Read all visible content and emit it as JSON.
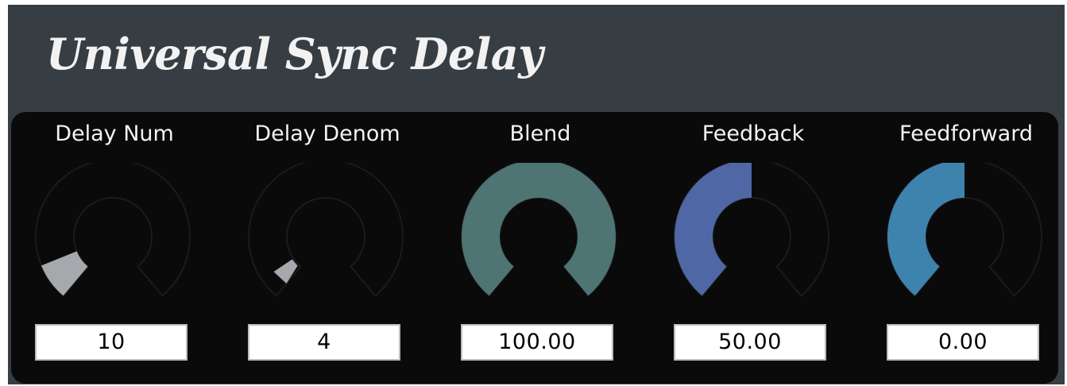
{
  "title": "Universal Sync Delay",
  "controls": [
    {
      "label": "Delay Num",
      "value": "10",
      "fraction": 0.1,
      "color": "#a5a8ac",
      "fill_mode": "pointer"
    },
    {
      "label": "Delay Denom",
      "value": "4",
      "fraction": 0.04,
      "color": "#a5a8ac",
      "fill_mode": "pointer"
    },
    {
      "label": "Blend",
      "value": "100.00",
      "fraction": 1.0,
      "color": "#4e7474",
      "fill_mode": "range"
    },
    {
      "label": "Feedback",
      "value": "50.00",
      "fraction": 0.5,
      "color": "#5067a6",
      "fill_mode": "range"
    },
    {
      "label": "Feedforward",
      "value": "0.00",
      "fraction": 0.5,
      "color": "#3e83ad",
      "fill_mode": "range"
    }
  ]
}
